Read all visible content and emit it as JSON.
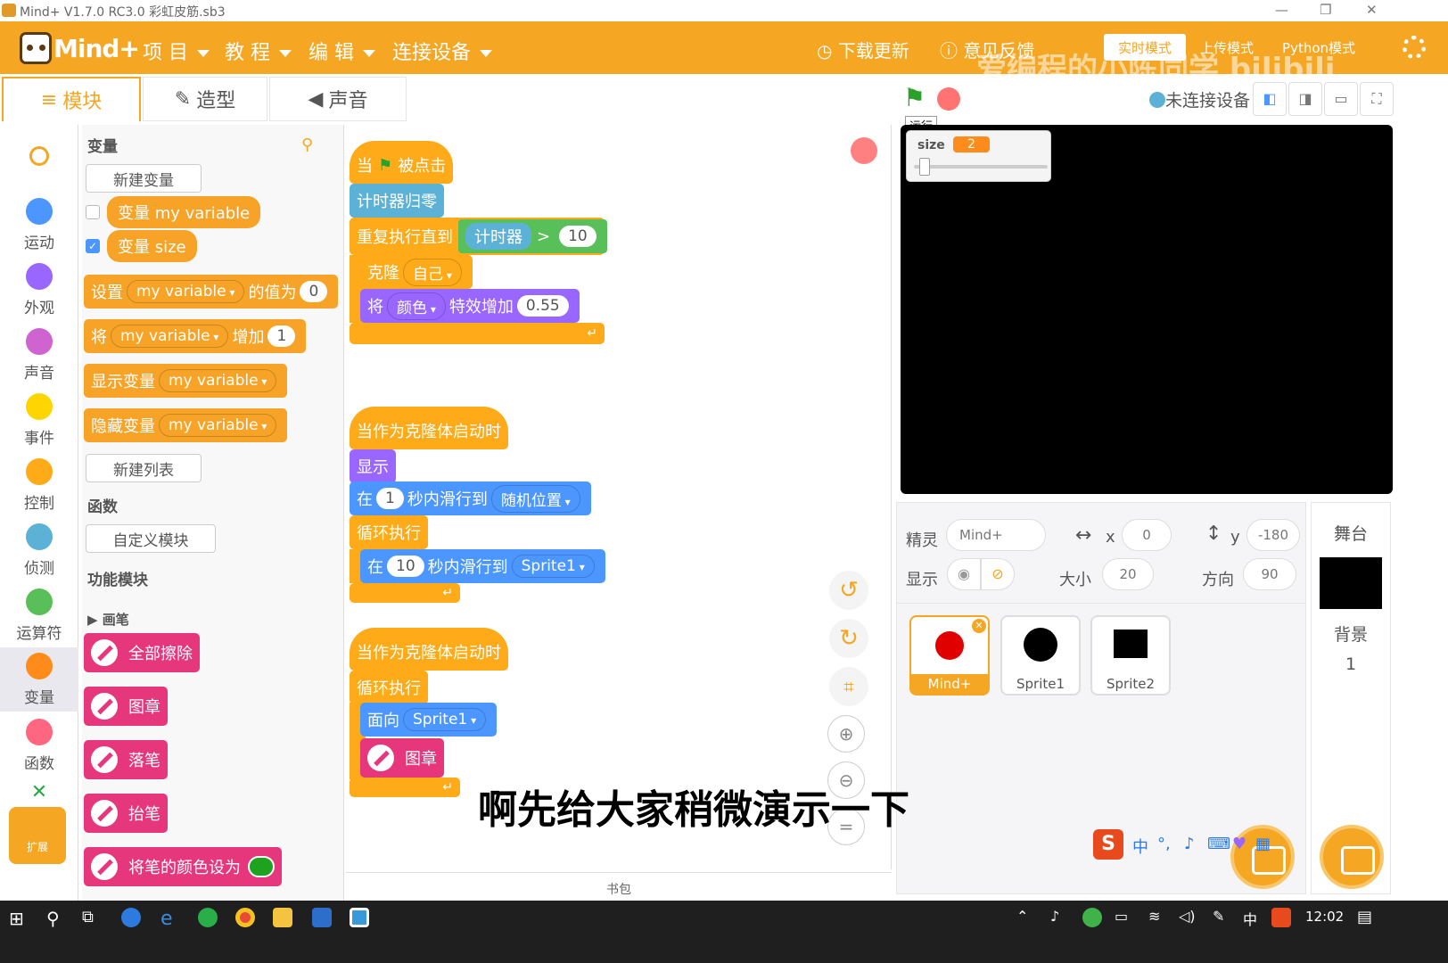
{
  "window": {
    "title": "Mind+ V1.7.0 RC3.0   彩虹皮筋.sb3",
    "min": "—",
    "max": "❐",
    "close": "✕"
  },
  "menubar": {
    "logo": "Mind+",
    "items": [
      "项 目",
      "教 程",
      "编 辑",
      "连接设备"
    ],
    "download": "下载更新",
    "feedback": "意见反馈",
    "modes": [
      "实时模式",
      "上传模式",
      "Python模式"
    ]
  },
  "watermark": "爱编程的小陈同学 bilibili",
  "tabs": [
    "模块",
    "造型",
    "声音"
  ],
  "categories": [
    {
      "label": "运动",
      "color": "#4c97ff"
    },
    {
      "label": "外观",
      "color": "#9966ff"
    },
    {
      "label": "声音",
      "color": "#cf63cf"
    },
    {
      "label": "事件",
      "color": "#ffd500"
    },
    {
      "label": "控制",
      "color": "#ffab19"
    },
    {
      "label": "侦测",
      "color": "#5cb1d6"
    },
    {
      "label": "运算符",
      "color": "#59c059"
    },
    {
      "label": "变量",
      "color": "#ff8c1a"
    },
    {
      "label": "函数",
      "color": "#ff6680"
    }
  ],
  "extension": "扩展",
  "palette": {
    "section_variables": "变量",
    "new_variable": "新建变量",
    "var_my": "变量 my variable",
    "var_size": "变量 size",
    "set_1": "设置",
    "set_var": "my variable",
    "set_2": "的值为",
    "set_val": "0",
    "change_1": "将",
    "change_var": "my variable",
    "change_2": "增加",
    "change_val": "1",
    "show_var": "显示变量",
    "show_var_name": "my variable",
    "hide_var": "隐藏变量",
    "hide_var_name": "my variable",
    "new_list": "新建列表",
    "section_functions": "函数",
    "custom_block": "自定义模块",
    "section_features": "功能模块",
    "pen_group": "画笔",
    "pen_clear": "全部擦除",
    "pen_stamp": "图章",
    "pen_down": "落笔",
    "pen_up": "抬笔",
    "pen_color": "将笔的颜色设为"
  },
  "scripts": {
    "s1": {
      "hat_1": "当",
      "hat_2": "被点击",
      "reset_timer": "计时器归零",
      "repeat_until": "重复执行直到",
      "timer": "计时器",
      "op": ">",
      "op_val": "10",
      "clone": "克隆",
      "clone_target": "自己",
      "effect_1": "将",
      "effect_name": "颜色",
      "effect_2": "特效增加",
      "effect_val": "0.55"
    },
    "s2": {
      "hat": "当作为克隆体启动时",
      "show": "显示",
      "glide_1": "在",
      "glide_secs": "1",
      "glide_2": "秒内滑行到",
      "glide_target": "随机位置",
      "forever": "循环执行",
      "glide2_1": "在",
      "glide2_secs": "10",
      "glide2_2": "秒内滑行到",
      "glide2_target": "Sprite1"
    },
    "s3": {
      "hat": "当作为克隆体启动时",
      "forever": "循环执行",
      "face": "面向",
      "face_target": "Sprite1",
      "stamp": "图章"
    }
  },
  "backpack": "书包",
  "stage_bar": {
    "run_tooltip": "运行",
    "device_status": "未连接设备"
  },
  "monitor": {
    "label": "size",
    "value": "2"
  },
  "sprite_info": {
    "sprite_label": "精灵",
    "sprite_name": "Mind+",
    "x_label": "x",
    "x": "0",
    "y_label": "y",
    "y": "-180",
    "show_label": "显示",
    "size_label": "大小",
    "size": "20",
    "dir_label": "方向",
    "direction": "90"
  },
  "sprites": [
    {
      "name": "Mind+",
      "color": "#e00000"
    },
    {
      "name": "Sprite1",
      "color": "#000000"
    },
    {
      "name": "Sprite2",
      "color": "#000000"
    }
  ],
  "stage_col": {
    "title": "舞台",
    "backdrop_label": "背景",
    "backdrop_count": "1"
  },
  "subtitle": "啊先给大家稍微演示一下",
  "ime": {
    "lang": "中"
  },
  "taskbar": {
    "lang": "中",
    "time": "12:02"
  }
}
